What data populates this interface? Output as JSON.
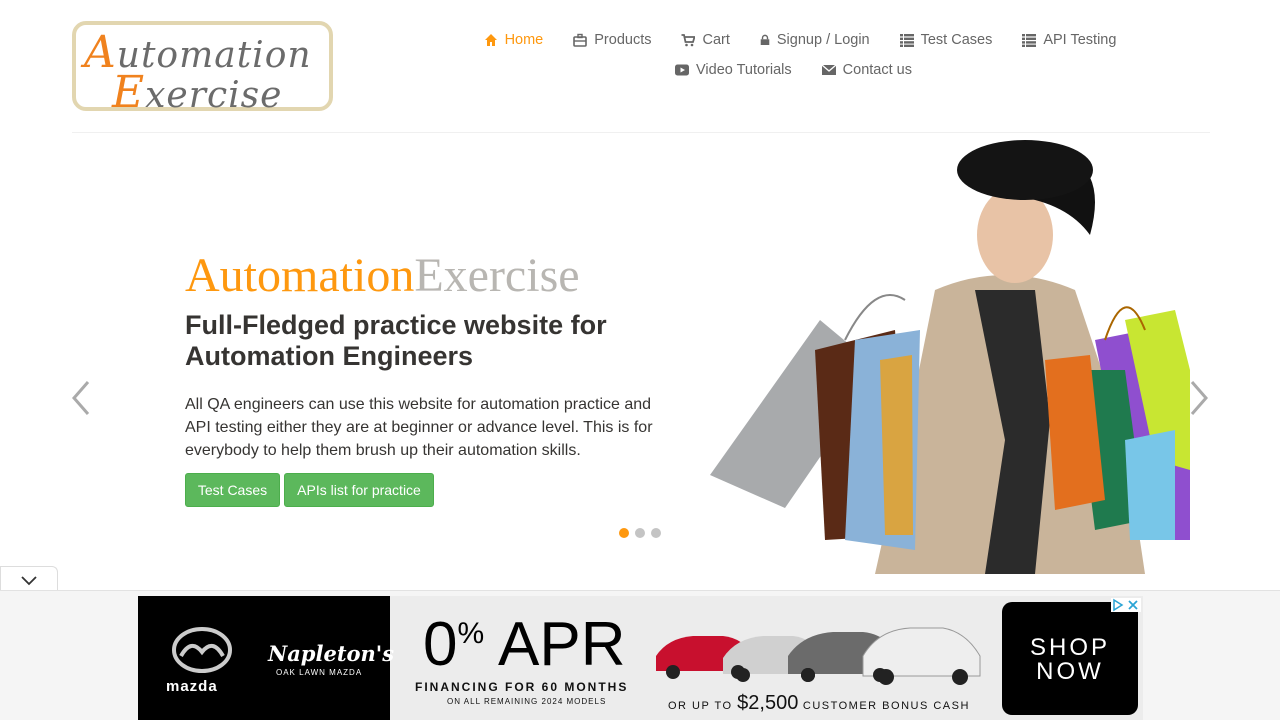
{
  "logo": {
    "line1_cap": "A",
    "line1_rest": "utomation",
    "line2_cap": "E",
    "line2_rest": "xercise"
  },
  "nav": [
    {
      "label": "Home",
      "icon": "home-icon",
      "active": true
    },
    {
      "label": "Products",
      "icon": "briefcase-icon"
    },
    {
      "label": "Cart",
      "icon": "cart-icon"
    },
    {
      "label": "Signup / Login",
      "icon": "lock-icon"
    },
    {
      "label": "Test Cases",
      "icon": "list-icon"
    },
    {
      "label": "API Testing",
      "icon": "list-icon"
    },
    {
      "label": "Video Tutorials",
      "icon": "youtube-icon"
    },
    {
      "label": "Contact us",
      "icon": "envelope-icon"
    }
  ],
  "slider": {
    "title_part1": "Automation",
    "title_part2": "Exercise",
    "subtitle": "Full-Fledged practice website for Automation Engineers",
    "description": "All QA engineers can use this website for automation practice and API testing either they are at beginner or advance level. This is for everybody to help them brush up their automation skills.",
    "button_test_cases": "Test Cases",
    "button_apis": "APIs list for practice",
    "active_slide": 1,
    "slide_count": 3
  },
  "ad": {
    "brand": "mazda",
    "dealer": "Napleton's",
    "dealer_sub": "OAK LAWN MAZDA",
    "apr_value": "0",
    "apr_symbol": "%",
    "apr_label": "APR",
    "financing": "FINANCING FOR 60 MONTHS",
    "financing_sub": "ON ALL REMAINING 2024 MODELS",
    "bonus_prefix": "OR UP TO",
    "bonus_amount": "$2,500",
    "bonus_suffix": "CUSTOMER BONUS CASH",
    "cta_line1": "SHOP",
    "cta_line2": "NOW"
  },
  "colors": {
    "accent": "#fe980f",
    "button": "#5cb85c",
    "title_grey": "#b8b6b2"
  }
}
